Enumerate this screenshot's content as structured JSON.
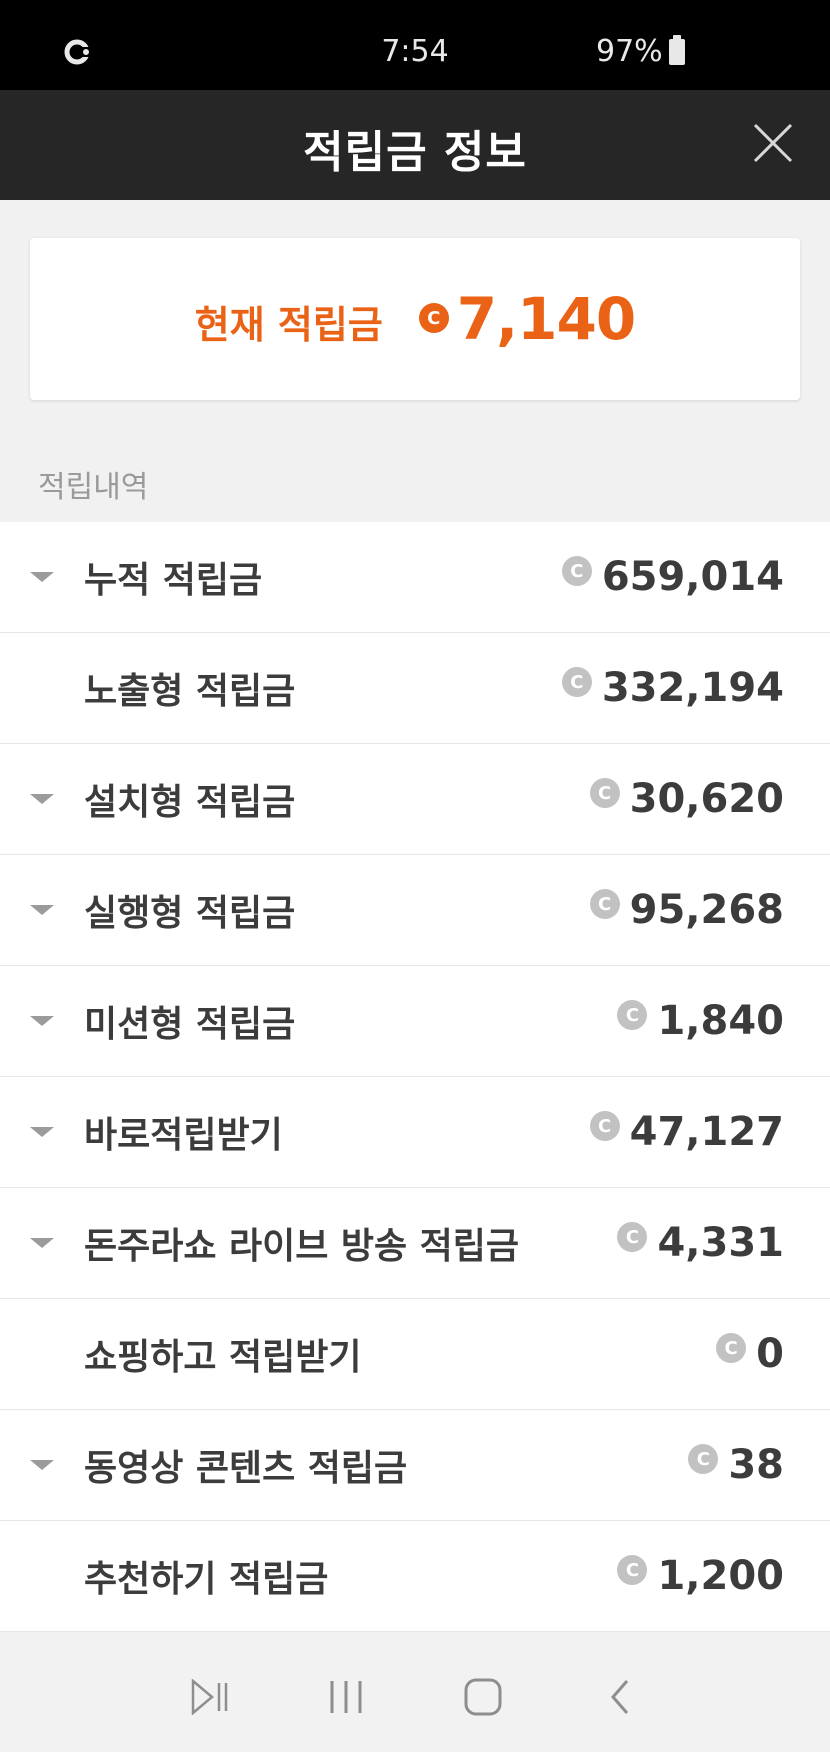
{
  "status_bar": {
    "time": "7:54",
    "battery": "97%"
  },
  "header": {
    "title": "적립금 정보"
  },
  "balance": {
    "label": "현재 적립금",
    "amount": "7,140",
    "accent_color": "#ea6216"
  },
  "history": {
    "section_label": "적립내역",
    "rows": [
      {
        "label": "누적 적립금",
        "amount": "659,014",
        "expandable": true
      },
      {
        "label": "노출형 적립금",
        "amount": "332,194",
        "expandable": false
      },
      {
        "label": "설치형 적립금",
        "amount": "30,620",
        "expandable": true
      },
      {
        "label": "실행형 적립금",
        "amount": "95,268",
        "expandable": true
      },
      {
        "label": "미션형 적립금",
        "amount": "1,840",
        "expandable": true
      },
      {
        "label": "바로적립받기",
        "amount": "47,127",
        "expandable": true
      },
      {
        "label": "돈주라쇼 라이브 방송 적립금",
        "amount": "4,331",
        "expandable": true
      },
      {
        "label": "쇼핑하고 적립받기",
        "amount": "0",
        "expandable": false
      },
      {
        "label": "동영상 콘텐츠 적립금",
        "amount": "38",
        "expandable": true
      },
      {
        "label": "추천하기 적립금",
        "amount": "1,200",
        "expandable": false
      }
    ]
  },
  "icons": {
    "coin": "C",
    "close": "close-icon",
    "caret": "caret-down-icon"
  }
}
